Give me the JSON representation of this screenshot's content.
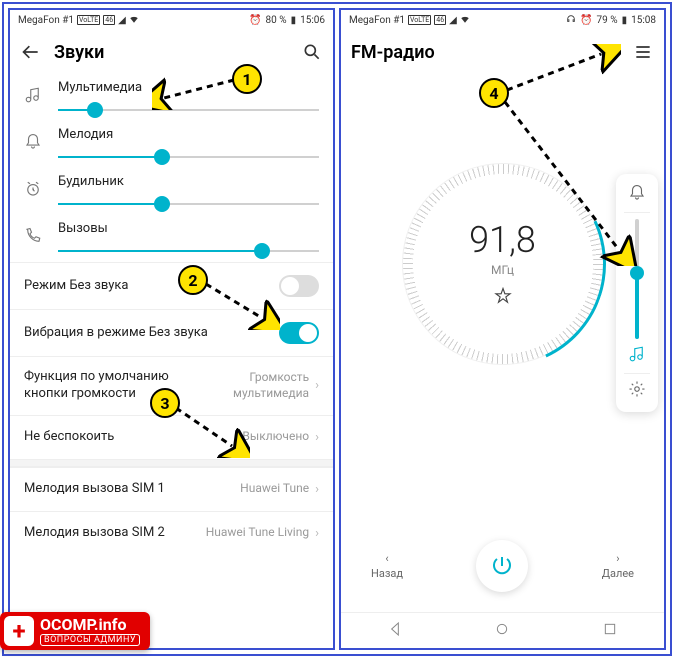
{
  "left": {
    "status": {
      "carrier": "MegaFon #1",
      "battery": "80 %",
      "time": "15:06"
    },
    "title": "Звуки",
    "sliders": [
      {
        "label": "Мультимедиа",
        "value": 14
      },
      {
        "label": "Мелодия",
        "value": 40
      },
      {
        "label": "Будильник",
        "value": 40
      },
      {
        "label": "Вызовы",
        "value": 78
      }
    ],
    "silent": {
      "label": "Режим Без звука",
      "on": false
    },
    "vibrate": {
      "label": "Вибрация в режиме Без звука",
      "on": true
    },
    "volbtn": {
      "label": "Функция по умолчанию кнопки громкости",
      "value": "Громкость мультимедиа"
    },
    "dnd": {
      "label": "Не беспокоить",
      "value": "Выключено"
    },
    "sim1": {
      "label": "Мелодия вызова SIM 1",
      "value": "Huawei Tune"
    },
    "sim2": {
      "label": "Мелодия вызова SIM 2",
      "value": "Huawei Tune Living"
    }
  },
  "right": {
    "status": {
      "carrier": "MegaFon #1",
      "battery": "79 %",
      "time": "15:08"
    },
    "title": "FM-радио",
    "freq": "91,8",
    "unit": "МГц",
    "back": "Назад",
    "fwd": "Далее",
    "side_volume": 55
  },
  "callouts": {
    "c1": "1",
    "c2": "2",
    "c3": "3",
    "c4": "4"
  },
  "watermark": {
    "brand": "OCOMP",
    "tld": ".info",
    "sub": "ВОПРОСЫ АДМИНУ"
  }
}
